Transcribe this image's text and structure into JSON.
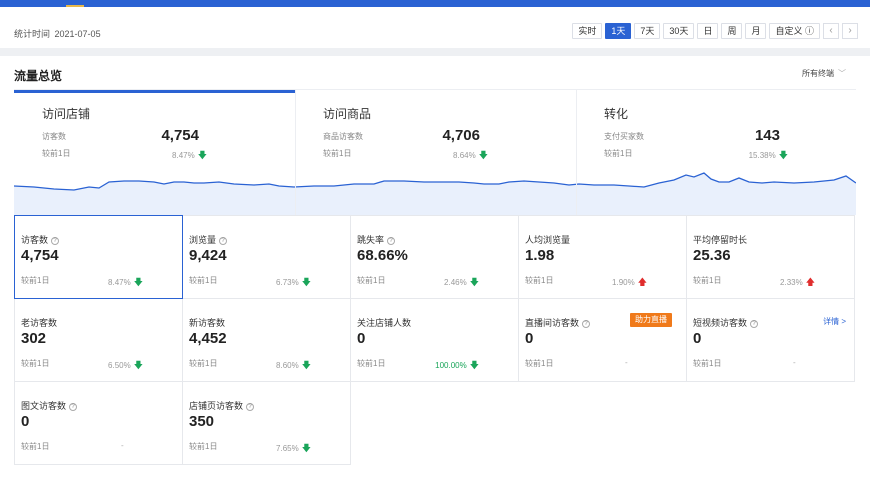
{
  "header": {
    "stat_time_label": "统计时间",
    "stat_time_value": "2021-07-05",
    "ranges": [
      {
        "label": "实时",
        "active": false
      },
      {
        "label": "1天",
        "active": true
      },
      {
        "label": "7天",
        "active": false
      },
      {
        "label": "30天",
        "active": false
      },
      {
        "label": "日",
        "active": false
      },
      {
        "label": "周",
        "active": false
      },
      {
        "label": "月",
        "active": false
      },
      {
        "label": "自定义 ⓘ",
        "active": false
      }
    ],
    "prev_icon": "chevron-left-icon",
    "next_icon": "chevron-right-icon"
  },
  "section": {
    "title": "流量总览",
    "channel_select": "所有终端"
  },
  "overview": [
    {
      "title": "访问店铺",
      "label": "访客数",
      "value": "4,754",
      "compare": "较前1日",
      "pct": "8.47%",
      "trend": "down",
      "active": true
    },
    {
      "title": "访问商品",
      "label": "商品访客数",
      "value": "4,706",
      "compare": "较前1日",
      "pct": "8.64%",
      "trend": "down",
      "active": false
    },
    {
      "title": "转化",
      "label": "支付买家数",
      "value": "143",
      "compare": "较前1日",
      "pct": "15.38%",
      "trend": "down",
      "active": false
    }
  ],
  "metrics": [
    {
      "title": "访客数",
      "help": true,
      "value": "4,754",
      "compare": "较前1日",
      "pct": "8.47%",
      "trend": "down",
      "active": true
    },
    {
      "title": "浏览量",
      "help": true,
      "value": "9,424",
      "compare": "较前1日",
      "pct": "6.73%",
      "trend": "down"
    },
    {
      "title": "跳失率",
      "help": true,
      "value": "68.66%",
      "compare": "较前1日",
      "pct": "2.46%",
      "trend": "down"
    },
    {
      "title": "人均浏览量",
      "help": false,
      "value": "1.98",
      "compare": "较前1日",
      "pct": "1.90%",
      "trend": "up"
    },
    {
      "title": "平均停留时长",
      "help": false,
      "value": "25.36",
      "compare": "较前1日",
      "pct": "2.33%",
      "trend": "up"
    },
    {
      "title": "老访客数",
      "help": false,
      "value": "302",
      "compare": "较前1日",
      "pct": "6.50%",
      "trend": "down"
    },
    {
      "title": "新访客数",
      "help": false,
      "value": "4,452",
      "compare": "较前1日",
      "pct": "8.60%",
      "trend": "down"
    },
    {
      "title": "关注店铺人数",
      "help": false,
      "value": "0",
      "compare": "较前1日",
      "pct": "100.00%",
      "trend": "down",
      "green": true
    },
    {
      "title": "直播间访客数",
      "help": true,
      "value": "0",
      "compare": "较前1日",
      "pct": "-",
      "trend": "none",
      "badge": "助力直播"
    },
    {
      "title": "短视频访客数",
      "help": true,
      "value": "0",
      "compare": "较前1日",
      "pct": "-",
      "trend": "none",
      "link": "详情 >"
    },
    {
      "title": "图文访客数",
      "help": true,
      "value": "0",
      "compare": "较前1日",
      "pct": "-",
      "trend": "none"
    },
    {
      "title": "店铺页访客数",
      "help": true,
      "value": "350",
      "compare": "较前1日",
      "pct": "7.65%",
      "trend": "down"
    }
  ],
  "colors": {
    "accent": "#2a62d3",
    "down": "#1aa55a",
    "up": "#e02d2d",
    "badge": "#f07a1a"
  }
}
